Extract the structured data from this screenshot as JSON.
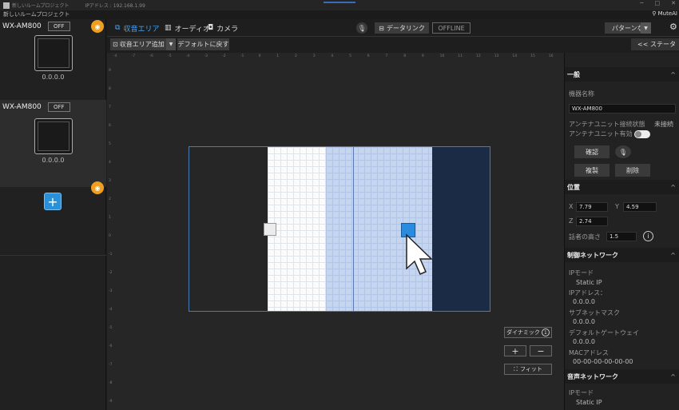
{
  "titlebar": {
    "project_name": "新しいルームプロジェクト",
    "ip_address": "IPアドレス : 192.168.1.99",
    "minimize": "─",
    "maximize": "□",
    "close": "✕"
  },
  "projectbar": {
    "name": "新しいルームプロジェクト",
    "mute_ai": "MuteAI"
  },
  "devices": [
    {
      "name": "WX-AM800",
      "status": "OFF",
      "ip": "0.0.0.0"
    },
    {
      "name": "WX-AM800",
      "status": "OFF",
      "ip": "0.0.0.0"
    }
  ],
  "add_button": "+",
  "tabs": {
    "sound_area": "収音エリア",
    "audio": "オーディオ",
    "camera": "カメラ"
  },
  "datalink": "データリンク",
  "offline": "OFFLINE",
  "pattern": "パターンなし",
  "toolbar": {
    "add_area": "収音エリア追加",
    "reset_default": "デフォルトに戻す",
    "status": "<< ステータ"
  },
  "ruler": {
    "top": [
      "-4",
      "-7",
      "-6",
      "-5",
      "-4",
      "-3",
      "-2",
      "-1",
      "0",
      "1",
      "2",
      "3",
      "4",
      "5",
      "6",
      "7",
      "8",
      "9",
      "10",
      "11",
      "12",
      "13",
      "14",
      "15",
      "16"
    ],
    "left": [
      "9",
      "8",
      "7",
      "6",
      "5",
      "4",
      "3",
      "2",
      "1",
      "0",
      "-1",
      "-2",
      "-3",
      "-4",
      "-5",
      "-6",
      "-7",
      "-8",
      "-9"
    ]
  },
  "canvas_controls": {
    "dynamic": "ダイナミック",
    "dynamic_count": "1",
    "zoom_in": "+",
    "zoom_out": "−",
    "fit": "フィット"
  },
  "general": {
    "title": "一般",
    "device_name_label": "機器名称",
    "device_name": "WX-AM800",
    "antenna_status_label": "アンテナユニット接続状態",
    "antenna_status": "未接続",
    "antenna_enable_label": "アンテナユニット有効",
    "confirm": "確認",
    "duplicate": "複製",
    "delete": "削除"
  },
  "position": {
    "title": "位置",
    "x_label": "X",
    "x": "7.79",
    "y_label": "Y",
    "y": "4.59",
    "z_label": "Z",
    "z": "2.74",
    "speaker_height_label": "話者の高さ",
    "speaker_height": "1.5"
  },
  "control_network": {
    "title": "制御ネットワーク",
    "ip_mode_label": "IPモード",
    "ip_mode": "Static IP",
    "ip_label": "IPアドレス：",
    "ip": "0.0.0.0",
    "subnet_label": "サブネットマスク",
    "subnet": "0.0.0.0",
    "gateway_label": "デフォルトゲートウェイ",
    "gateway": "0.0.0.0",
    "mac_label": "MACアドレス",
    "mac": "00-00-00-00-00-00"
  },
  "audio_network": {
    "title": "音声ネットワーク",
    "ip_mode_label": "IPモード",
    "ip_mode": "Static IP"
  },
  "colors": {
    "accent": "#2a8ce0",
    "eye_badge": "#f0a020",
    "zone_blue": "#c6d5ee",
    "zone_dark": "#1c2b45"
  }
}
